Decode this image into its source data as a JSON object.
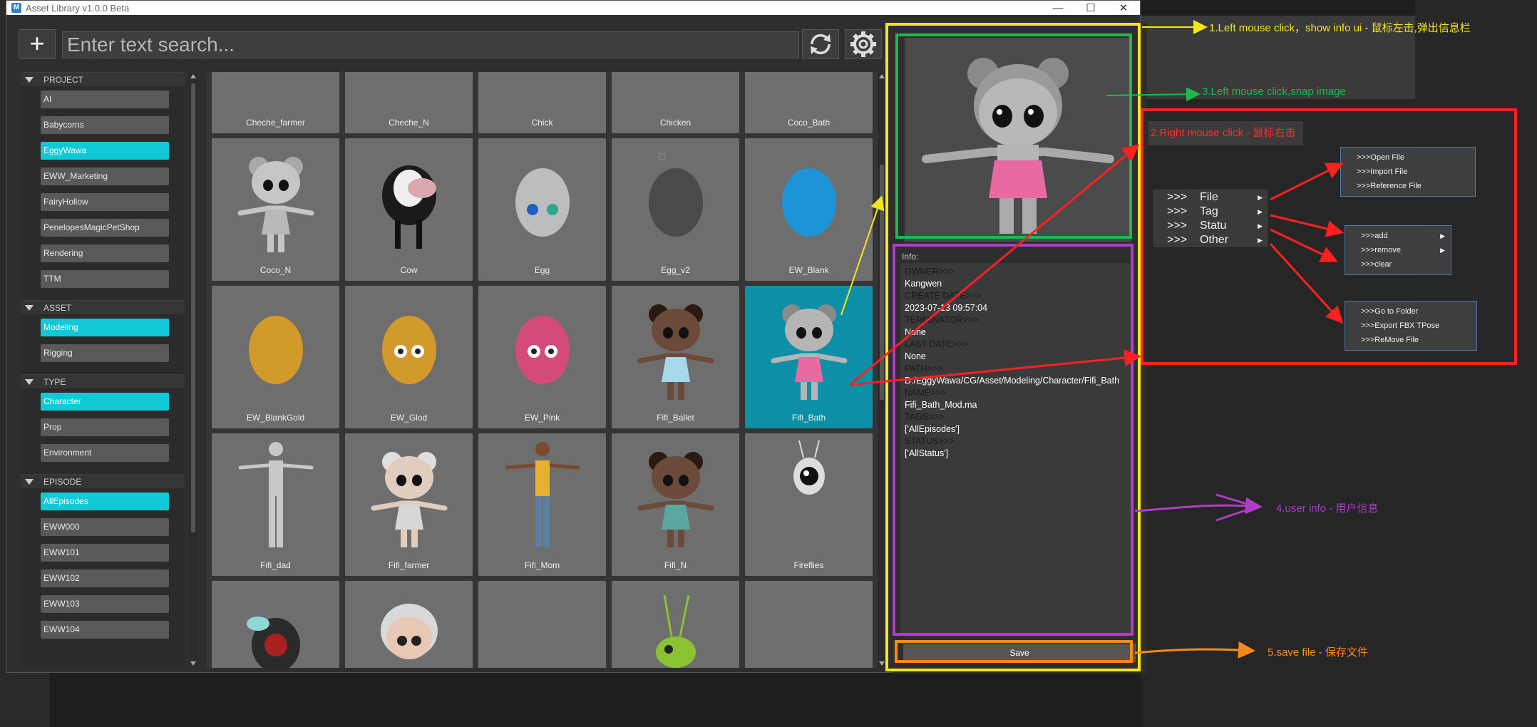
{
  "window": {
    "title": "Asset Library v1.0.0 Beta",
    "app_icon_letter": "M",
    "controls": {
      "minimize": "—",
      "maximize": "☐",
      "close": "✕"
    }
  },
  "toolbar": {
    "add_label": "+",
    "search_placeholder": "Enter text search...",
    "refresh_icon": "refresh-icon",
    "settings_icon": "gear-icon"
  },
  "sidebar": {
    "sections": [
      {
        "title": "PROJECT",
        "items": [
          {
            "label": "AI",
            "active": false
          },
          {
            "label": "Babycorns",
            "active": false
          },
          {
            "label": "EggyWawa",
            "active": true
          },
          {
            "label": "EWW_Marketing",
            "active": false
          },
          {
            "label": "FairyHollow",
            "active": false
          },
          {
            "label": "PenelopesMagicPetShop",
            "active": false
          },
          {
            "label": "Rendering",
            "active": false
          },
          {
            "label": "TTM",
            "active": false
          }
        ]
      },
      {
        "title": "ASSET",
        "items": [
          {
            "label": "Modeling",
            "active": true
          },
          {
            "label": "Rigging",
            "active": false
          }
        ]
      },
      {
        "title": "TYPE",
        "items": [
          {
            "label": "Character",
            "active": true
          },
          {
            "label": "Prop",
            "active": false
          },
          {
            "label": "Environment",
            "active": false
          }
        ]
      },
      {
        "title": "EPISODE",
        "items": [
          {
            "label": "AllEpisodes",
            "active": true
          },
          {
            "label": "EWW000",
            "active": false
          },
          {
            "label": "EWW101",
            "active": false
          },
          {
            "label": "EWW102",
            "active": false
          },
          {
            "label": "EWW103",
            "active": false
          },
          {
            "label": "EWW104",
            "active": false
          }
        ]
      }
    ]
  },
  "assets": [
    {
      "name": "Cheche_farmer",
      "art": "figure-grey"
    },
    {
      "name": "Cheche_N",
      "art": "figure-striped"
    },
    {
      "name": "Chick",
      "art": "chick"
    },
    {
      "name": "Chicken",
      "art": "chicken"
    },
    {
      "name": "Coco_Bath",
      "art": "figure-purple"
    },
    {
      "name": "Coco_N",
      "art": "girl-grey"
    },
    {
      "name": "Cow",
      "art": "cow"
    },
    {
      "name": "Egg",
      "art": "egg-grey"
    },
    {
      "name": "Egg_v2",
      "art": "egg-dark"
    },
    {
      "name": "EW_Blank",
      "art": "egg-blue"
    },
    {
      "name": "EW_BlankGold",
      "art": "egg-gold"
    },
    {
      "name": "EW_Glod",
      "art": "egg-gold-eyes"
    },
    {
      "name": "EW_Pink",
      "art": "egg-pink"
    },
    {
      "name": "Fifi_Ballet",
      "art": "girl-ballet"
    },
    {
      "name": "Fifi_Bath",
      "art": "girl-pink",
      "selected": true
    },
    {
      "name": "Fifi_dad",
      "art": "man-grey"
    },
    {
      "name": "Fifi_farmer",
      "art": "girl-small"
    },
    {
      "name": "Fifi_Mom",
      "art": "woman"
    },
    {
      "name": "Fifi_N",
      "art": "girl-dark"
    },
    {
      "name": "Fireflies",
      "art": "firefly"
    },
    {
      "name": "",
      "art": "bug-red"
    },
    {
      "name": "",
      "art": "granny"
    },
    {
      "name": "",
      "art": "empty"
    },
    {
      "name": "",
      "art": "grasshopper"
    },
    {
      "name": "",
      "art": "empty"
    }
  ],
  "info": {
    "header": "Info:",
    "lines": [
      {
        "text": "OWNER>>>",
        "key": true
      },
      {
        "text": "Kangwen",
        "key": false
      },
      {
        "text": "CREATE DATE>>>",
        "key": true
      },
      {
        "text": "2023-07-13 09:57:04",
        "key": false
      },
      {
        "text": "TERMINATOR>>>",
        "key": true
      },
      {
        "text": "None",
        "key": false
      },
      {
        "text": "LAST DATE>>>",
        "key": true
      },
      {
        "text": "None",
        "key": false
      },
      {
        "text": "PATH>>>",
        "key": true
      },
      {
        "text": "D:/EggyWawa/CG/Asset/Modeling/Character/Fifi_Bath",
        "key": false
      },
      {
        "text": "NAME>>>",
        "key": true
      },
      {
        "text": "Fifi_Bath_Mod.ma",
        "key": false
      },
      {
        "text": "TAGS>>>",
        "key": true
      },
      {
        "text": "['AllEpisodes']",
        "key": false
      },
      {
        "text": "STATUS>>>",
        "key": true
      },
      {
        "text": "['AllStatus']",
        "key": false
      }
    ],
    "save_label": "Save"
  },
  "annotations": {
    "a1": "1.Left mouse click，show info ui - 鼠标左击,弹出信息栏",
    "a2": "2.Right mouse click - 鼠标右击",
    "a3": "3.Left mouse click,snap image",
    "a4": "4.user info - 用户信息",
    "a5": "5.save file - 保存文件",
    "colors": {
      "yellow": "#f5e61a",
      "green": "#1fb84a",
      "red": "#ff2020",
      "purple": "#b03cc8",
      "orange": "#ff8a1a"
    }
  },
  "context_menu": {
    "main": [
      {
        "arrows": ">>>",
        "label": "File"
      },
      {
        "arrows": ">>>",
        "label": "Tag"
      },
      {
        "arrows": ">>>",
        "label": "Statu"
      },
      {
        "arrows": ">>>",
        "label": "Other"
      }
    ],
    "file_sub": [
      ">>>Open File",
      ">>>Import File",
      ">>>Reference File"
    ],
    "tag_sub": [
      ">>>add",
      ">>>remove",
      ">>>clear"
    ],
    "other_sub": [
      ">>>Go to Folder",
      ">>>Export FBX TPose",
      ">>>ReMove File"
    ]
  }
}
